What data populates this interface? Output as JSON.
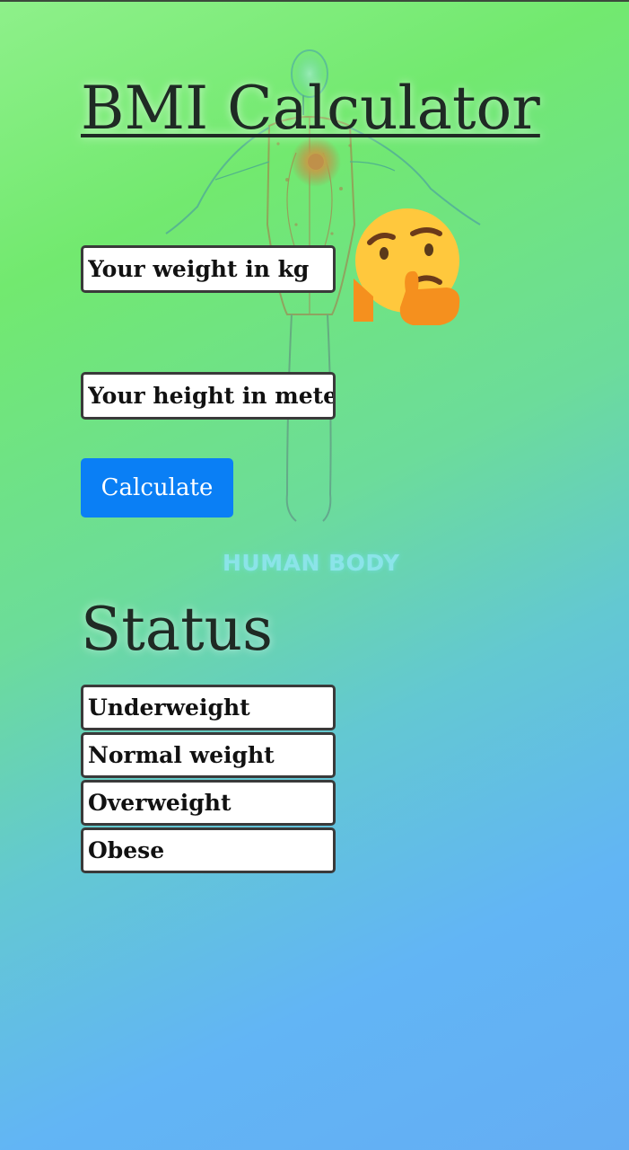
{
  "app": {
    "title": "BMI Calculator"
  },
  "form": {
    "weight_placeholder": "Your weight in kg",
    "height_placeholder": "Your height in meters",
    "calculate_label": "Calculate"
  },
  "illustration": {
    "caption": "HUMAN BODY",
    "icon": "human-body-illustration"
  },
  "emoji": {
    "icon": "thinking-face-emoji",
    "color": "#ffc83d"
  },
  "status": {
    "heading": "Status",
    "items": [
      {
        "label": "Underweight"
      },
      {
        "label": "Normal weight"
      },
      {
        "label": "Overweight"
      },
      {
        "label": "Obese"
      }
    ]
  },
  "colors": {
    "button": "#0a7ff5",
    "gradient_start": "#8ef08a",
    "gradient_end": "#64adf3"
  }
}
